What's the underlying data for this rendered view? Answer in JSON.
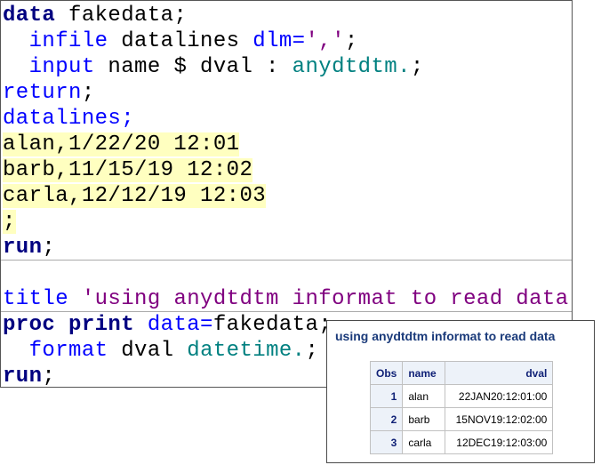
{
  "code": {
    "l1": {
      "kw": "data",
      "rest": " fakedata;"
    },
    "l2": {
      "indent": "  ",
      "stmt": "infile",
      "mid": " datalines ",
      "opt": "dlm=",
      "str": "','",
      "end": ";"
    },
    "l3": {
      "indent": "  ",
      "stmt": "input",
      "mid": " name $ dval : ",
      "fmt": "anydtdtm.",
      "end": ";"
    },
    "l4": {
      "stmt": "return",
      "end": ";"
    },
    "l5": {
      "stmt": "datalines",
      "end": ";"
    },
    "l6": "alan,1/22/20 12:01",
    "l7": "barb,11/15/19 12:02",
    "l8": "carla,12/12/19 12:03",
    "l9": ";",
    "l10": {
      "kw": "run",
      "end": ";"
    },
    "l11": {
      "stmt": "title",
      "sp": " ",
      "str": "'using anydtdtm informat to read data'",
      "end": ";"
    },
    "l12": {
      "kw": "proc print",
      "sp": " ",
      "opt": "data=",
      "rest": "fakedata;"
    },
    "l13": {
      "indent": "  ",
      "stmt": "format",
      "mid": " dval ",
      "fmt": "datetime.",
      "end": ";"
    },
    "l14": {
      "kw": "run",
      "end": ";"
    }
  },
  "output": {
    "title": "using anydtdtm informat to read data",
    "headers": {
      "obs": "Obs",
      "name": "name",
      "dval": "dval"
    },
    "rows": [
      {
        "obs": "1",
        "name": "alan",
        "dval": "22JAN20:12:01:00"
      },
      {
        "obs": "2",
        "name": "barb",
        "dval": "15NOV19:12:02:00"
      },
      {
        "obs": "3",
        "name": "carla",
        "dval": "12DEC19:12:03:00"
      }
    ]
  },
  "colors": {
    "keyword": "#000080",
    "statement": "#0000ff",
    "format": "#008080",
    "string": "#800080",
    "highlight": "#ffffc0",
    "output_title": "#1a3a7a",
    "header_bg": "#edf2f9"
  }
}
